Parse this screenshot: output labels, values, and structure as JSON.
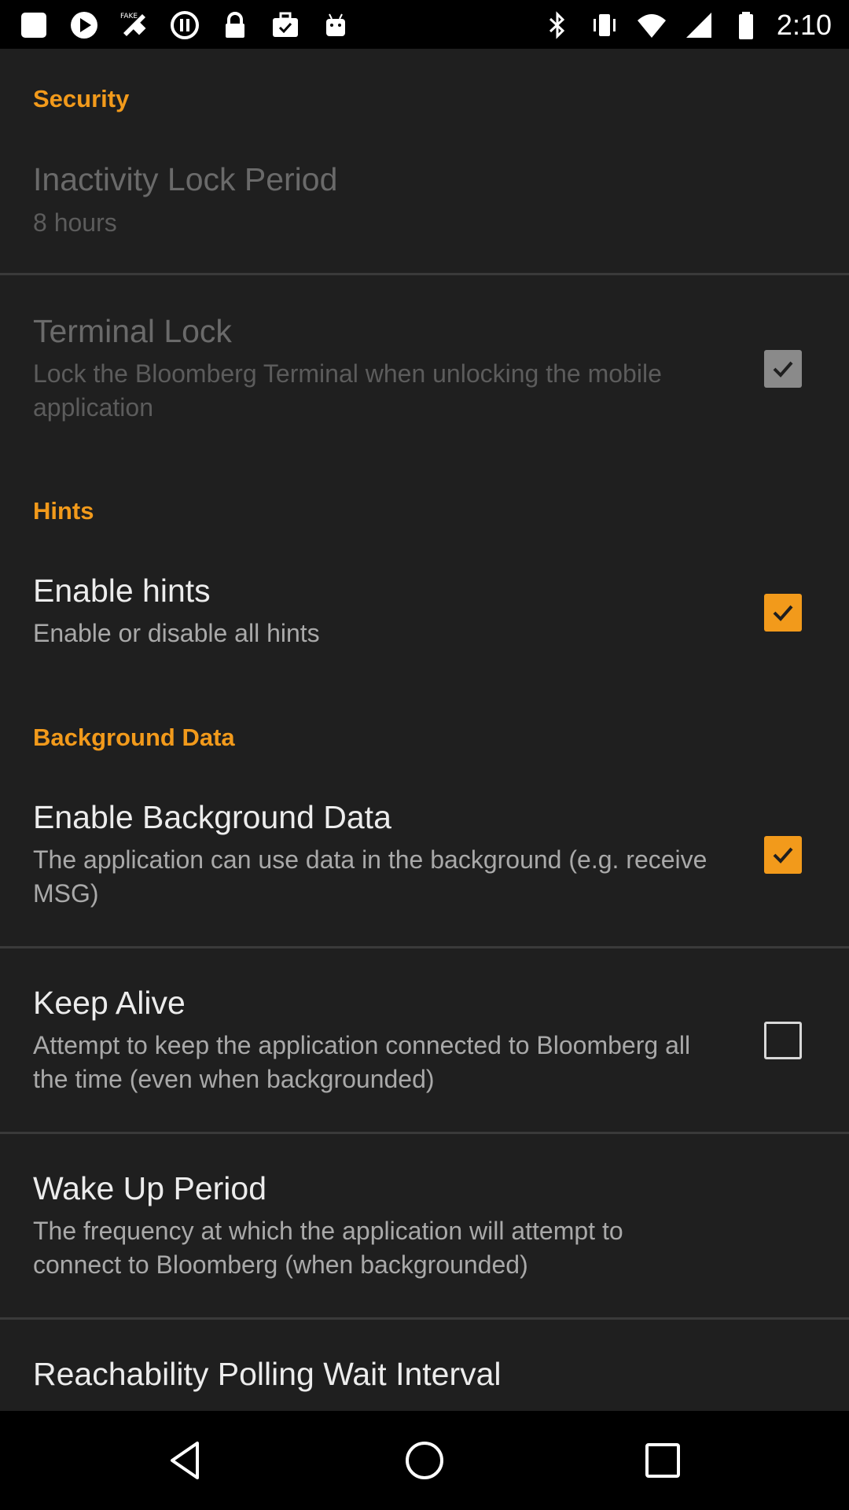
{
  "status_bar": {
    "time": "2:10",
    "left_icons": [
      "app-icon",
      "play-icon",
      "fake-gps-icon",
      "sync-icon",
      "lock-icon",
      "briefcase-icon",
      "android-icon"
    ],
    "right_icons": [
      "bluetooth-icon",
      "vibrate-icon",
      "wifi-icon",
      "signal-icon",
      "battery-icon"
    ]
  },
  "sections": {
    "security": {
      "header": "Security"
    },
    "hints": {
      "header": "Hints"
    },
    "background": {
      "header": "Background Data"
    }
  },
  "items": {
    "inactivity": {
      "title": "Inactivity Lock Period",
      "subtitle": "8 hours",
      "enabled": false
    },
    "terminal_lock": {
      "title": "Terminal Lock",
      "subtitle": "Lock the Bloomberg Terminal when unlocking the mobile application",
      "checked": true,
      "enabled": false
    },
    "enable_hints": {
      "title": "Enable hints",
      "subtitle": "Enable or disable all hints",
      "checked": true
    },
    "enable_background": {
      "title": "Enable Background Data",
      "subtitle": "The application can use data in the background (e.g. receive MSG)",
      "checked": true
    },
    "keep_alive": {
      "title": "Keep Alive",
      "subtitle": "Attempt to keep the application connected to Bloomberg all the time (even when backgrounded)",
      "checked": false
    },
    "wake_up": {
      "title": "Wake Up Period",
      "subtitle": "The frequency at which the application will attempt to connect to Bloomberg (when backgrounded)"
    },
    "reachability": {
      "title": "Reachability Polling Wait Interval"
    }
  },
  "colors": {
    "accent": "#f29a1b",
    "background": "#1f1f1f",
    "title_text": "#ececec",
    "subtitle_text": "#a9a9a9"
  },
  "nav_bar": {
    "buttons": [
      "back-icon",
      "home-icon",
      "recents-icon"
    ]
  }
}
